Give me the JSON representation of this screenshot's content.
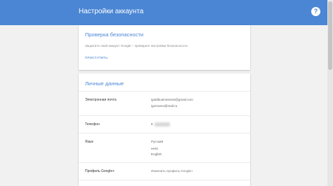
{
  "topbar": {
    "title": "Настройки аккаунта",
    "help_icon": "?"
  },
  "security": {
    "title": "Проверка безопасности",
    "description": "Защитите свой аккаунт Google – проверьте настройки безопасности.",
    "action": "ПРИСТУПИТЬ"
  },
  "personal": {
    "title": "Личные данные",
    "email": {
      "label": "Электронная почта",
      "values": [
        "igoldbusinessnet@gmail.com",
        "igomorev@mail.ru"
      ]
    },
    "phone": {
      "label": "Телефон",
      "value": "8"
    },
    "language": {
      "label": "Язык",
      "values": [
        "Русский",
        "eesti",
        "English"
      ]
    },
    "profile": {
      "label": "Профиль Google+",
      "link": "Изменить профиль Google+"
    }
  },
  "colors": {
    "accent": "#4a86d4",
    "background": "#f1f1f1"
  }
}
